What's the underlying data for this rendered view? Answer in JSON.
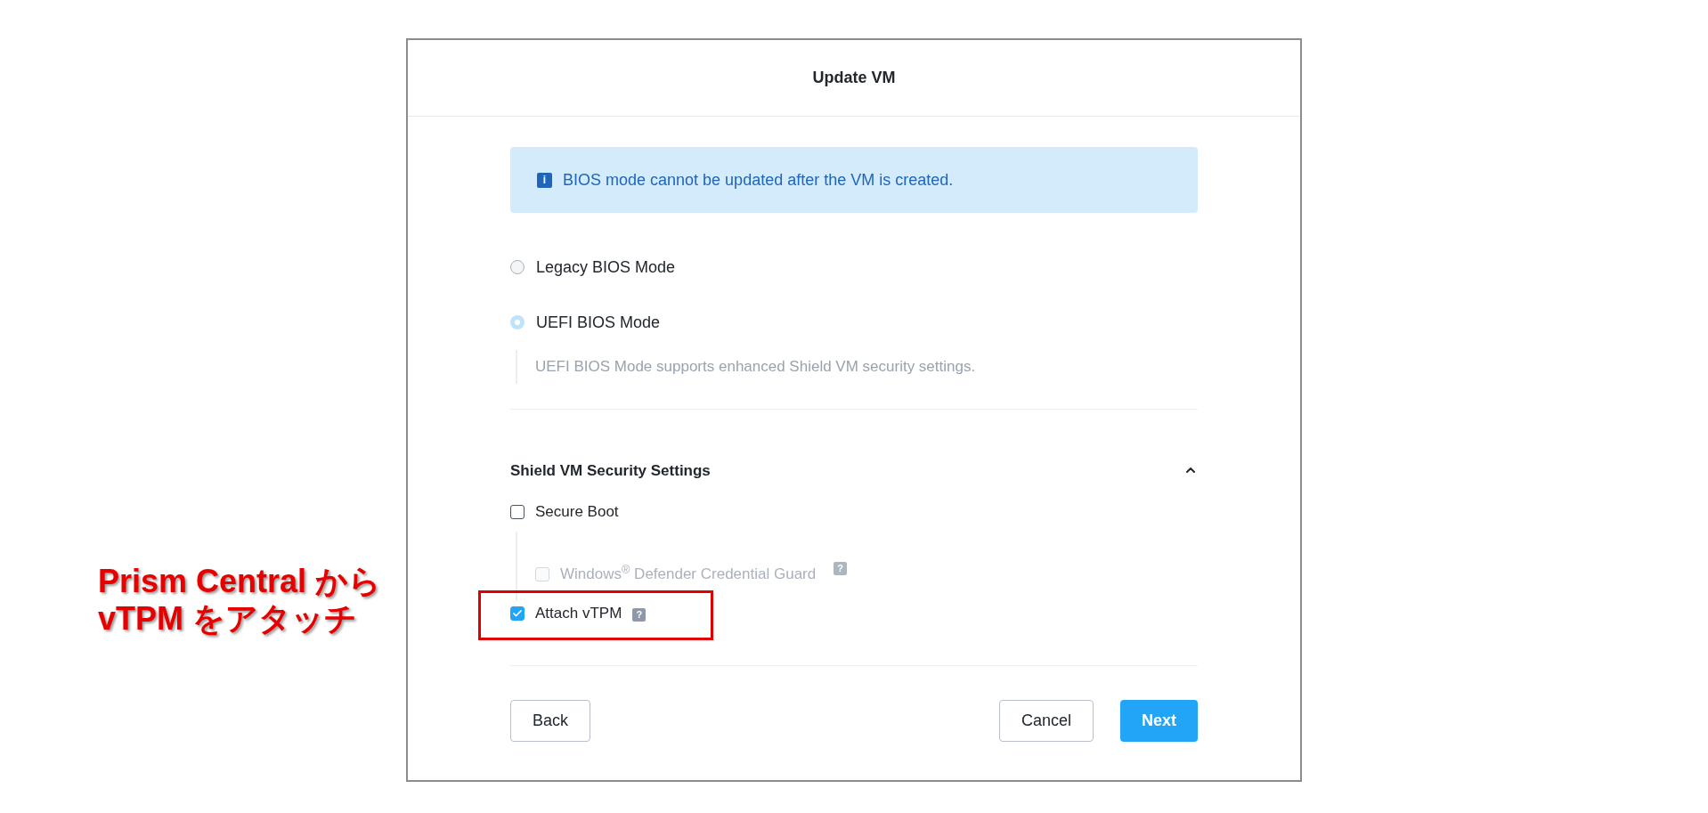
{
  "dialog": {
    "title": "Update VM",
    "boot_section": {
      "info": "BIOS mode cannot be updated after the VM is created.",
      "info_icon": "i",
      "radios": [
        {
          "label": "Legacy BIOS Mode",
          "selected": false
        },
        {
          "label": "UEFI BIOS Mode",
          "selected": true,
          "description": "UEFI BIOS Mode supports enhanced Shield VM security settings."
        }
      ]
    },
    "security_section": {
      "heading": "Shield VM Security Settings",
      "expanded": true,
      "options": [
        {
          "label": "Secure Boot",
          "checked": false,
          "disabled": false,
          "children": [
            {
              "label": "Windows$^{®}$ Defender Credential Guard",
              "checked": false,
              "disabled": true,
              "help": "?"
            }
          ]
        },
        {
          "label": "Attach vTPM",
          "checked": true,
          "disabled": false,
          "help": "?",
          "highlighted": true
        }
      ]
    },
    "buttons": [
      {
        "label": "Back",
        "kind": "secondary"
      },
      {
        "label": "Cancel",
        "kind": "secondary"
      },
      {
        "label": "Next",
        "kind": "primary"
      }
    ]
  },
  "annotation": {
    "lines": [
      "Prism Central から",
      "vTPM をアタッチ"
    ]
  }
}
